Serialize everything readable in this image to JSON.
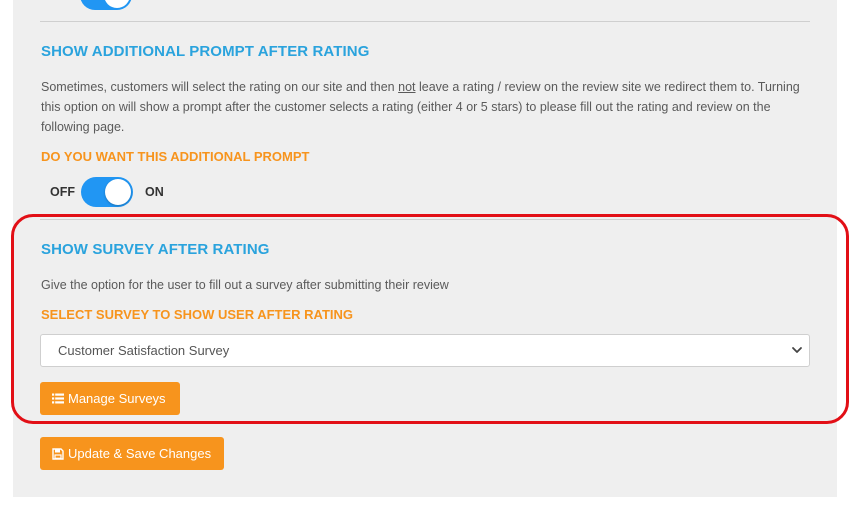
{
  "colors": {
    "heading": "#2aa3dd",
    "accent_orange": "#f7941d",
    "toggle_on": "#2196f3",
    "highlight_red": "#e20f16",
    "panel_bg": "#efefef"
  },
  "prompt_section": {
    "title": "SHOW ADDITIONAL PROMPT AFTER RATING",
    "desc_before": "Sometimes, customers will select the rating on our site and then ",
    "desc_underlined": "not",
    "desc_after": " leave a rating / review on the review site we redirect them to. Turning this option on will show a prompt after the customer selects a rating (either 4 or 5 stars) to please fill out the rating and review on the following page.",
    "question": "DO YOU WANT THIS ADDITIONAL PROMPT",
    "toggle_off_label": "OFF",
    "toggle_on_label": "ON",
    "toggle_state": "on"
  },
  "survey_section": {
    "title": "SHOW SURVEY AFTER RATING",
    "desc": "Give the option for the user to fill out a survey after submitting their review",
    "select_label": "SELECT SURVEY TO SHOW USER AFTER RATING",
    "selected_survey": "Customer Satisfaction Survey",
    "manage_button": "Manage Surveys",
    "manage_icon": "list-icon"
  },
  "save_button": {
    "label": "Update & Save Changes",
    "icon": "floppy-disk-icon"
  }
}
